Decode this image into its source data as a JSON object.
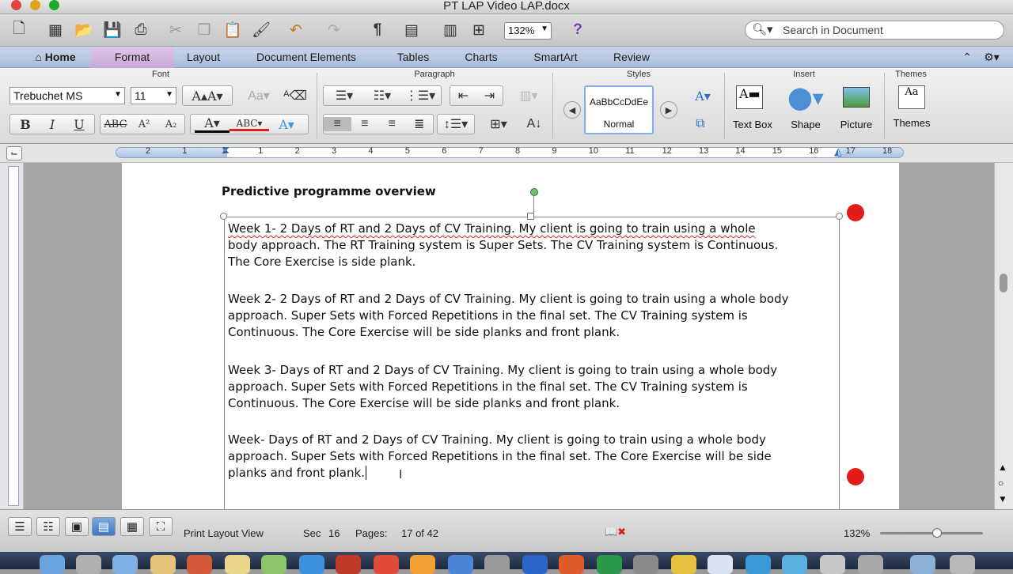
{
  "window": {
    "title": "PT LAP Video LAP.docx",
    "traffic_lights": {
      "close": "#e0443e",
      "minimize": "#dea123",
      "zoom": "#1aab29"
    }
  },
  "toolbar": {
    "zoom_value": "132%",
    "search_placeholder": "Search in Document",
    "icons": [
      "new-icon",
      "templates-icon",
      "open-icon",
      "save-icon",
      "print-icon",
      "cut-icon",
      "copy-icon",
      "paste-icon",
      "format-painter-icon",
      "undo-icon",
      "redo-icon",
      "pilcrow-icon",
      "sidebar-icon",
      "gallery-icon",
      "toolbox-icon",
      "help-icon"
    ]
  },
  "ribbon_tabs": [
    "Home",
    "Format",
    "Layout",
    "Document Elements",
    "Tables",
    "Charts",
    "SmartArt",
    "Review"
  ],
  "ribbon": {
    "groups": {
      "font": "Font",
      "paragraph": "Paragraph",
      "styles": "Styles",
      "insert": "Insert",
      "themes": "Themes"
    },
    "font_name": "Trebuchet MS",
    "font_size": "11",
    "style_preview": "AaBbCcDdEe",
    "style_name": "Normal",
    "insert_items": [
      "Text Box",
      "Shape",
      "Picture"
    ],
    "themes_label": "Themes"
  },
  "ruler": {
    "numbers": [
      "2",
      "1",
      "1",
      "1",
      "2",
      "3",
      "4",
      "5",
      "6",
      "7",
      "8",
      "9",
      "10",
      "11",
      "12",
      "13",
      "14",
      "15",
      "16",
      "17",
      "18"
    ]
  },
  "document": {
    "heading": "Predictive programme overview",
    "paragraphs": [
      {
        "lines": [
          "Week 1-  2 Days of RT and 2 Days of CV Training.  My client is going to train using a whole",
          "body approach.  The RT Training system is Super Sets.  The CV Training system is Continuous.",
          "The Core Exercise is side plank."
        ]
      },
      {
        "lines": [
          "Week 2- 2 Days of RT and 2 Days of CV Training.  My client is going to train using a whole body",
          "approach. Super Sets with Forced Repetitions in the final set. The CV Training system is",
          "Continuous.  The Core Exercise will be side planks and front plank."
        ]
      },
      {
        "lines": [
          "Week 3- Days of RT and 2 Days of CV Training.  My client is going to train using a whole body",
          "approach. Super Sets with Forced Repetitions in the final set. The CV Training system is",
          "Continuous.   The Core Exercise will be side planks and front plank."
        ]
      },
      {
        "lines": [
          "Week- Days of RT and 2 Days of CV Training.  My client is going to train using a whole body",
          "approach. Super Sets with Forced Repetitions in the final set. The Core Exercise will be side",
          "planks and front plank."
        ]
      }
    ],
    "annotation_color": "#e21b1b"
  },
  "statusbar": {
    "view": "Print Layout View",
    "sec_label": "Sec",
    "sec_value": "16",
    "pages_label": "Pages:",
    "pages_value": "17 of 42",
    "zoom": "132%"
  }
}
